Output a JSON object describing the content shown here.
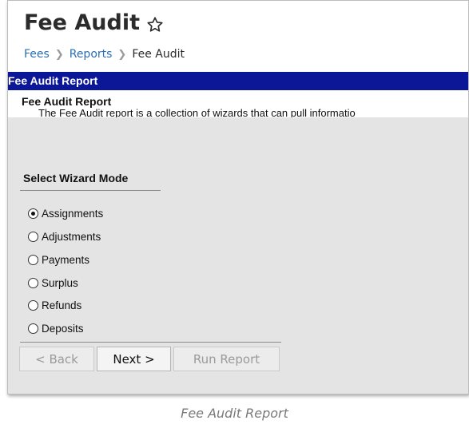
{
  "page": {
    "title": "Fee Audit",
    "breadcrumb": [
      "Fees",
      "Reports",
      "Fee Audit"
    ]
  },
  "banner": {
    "title": "Fee Audit Report"
  },
  "description": {
    "title": "Fee Audit Report",
    "text": "The Fee Audit report is a collection of wizards that can pull informatio"
  },
  "wizard": {
    "section_label": "Select Wizard Mode",
    "options": [
      {
        "label": "Assignments",
        "selected": true
      },
      {
        "label": "Adjustments",
        "selected": false
      },
      {
        "label": "Payments",
        "selected": false
      },
      {
        "label": "Surplus",
        "selected": false
      },
      {
        "label": "Refunds",
        "selected": false
      },
      {
        "label": "Deposits",
        "selected": false
      }
    ],
    "buttons": {
      "back": "< Back",
      "next": "Next >",
      "run": "Run Report"
    }
  },
  "caption": "Fee Audit Report",
  "colors": {
    "banner": "#0b1796",
    "link": "#2b6fb6",
    "panel_bg": "#e4e4e4"
  }
}
